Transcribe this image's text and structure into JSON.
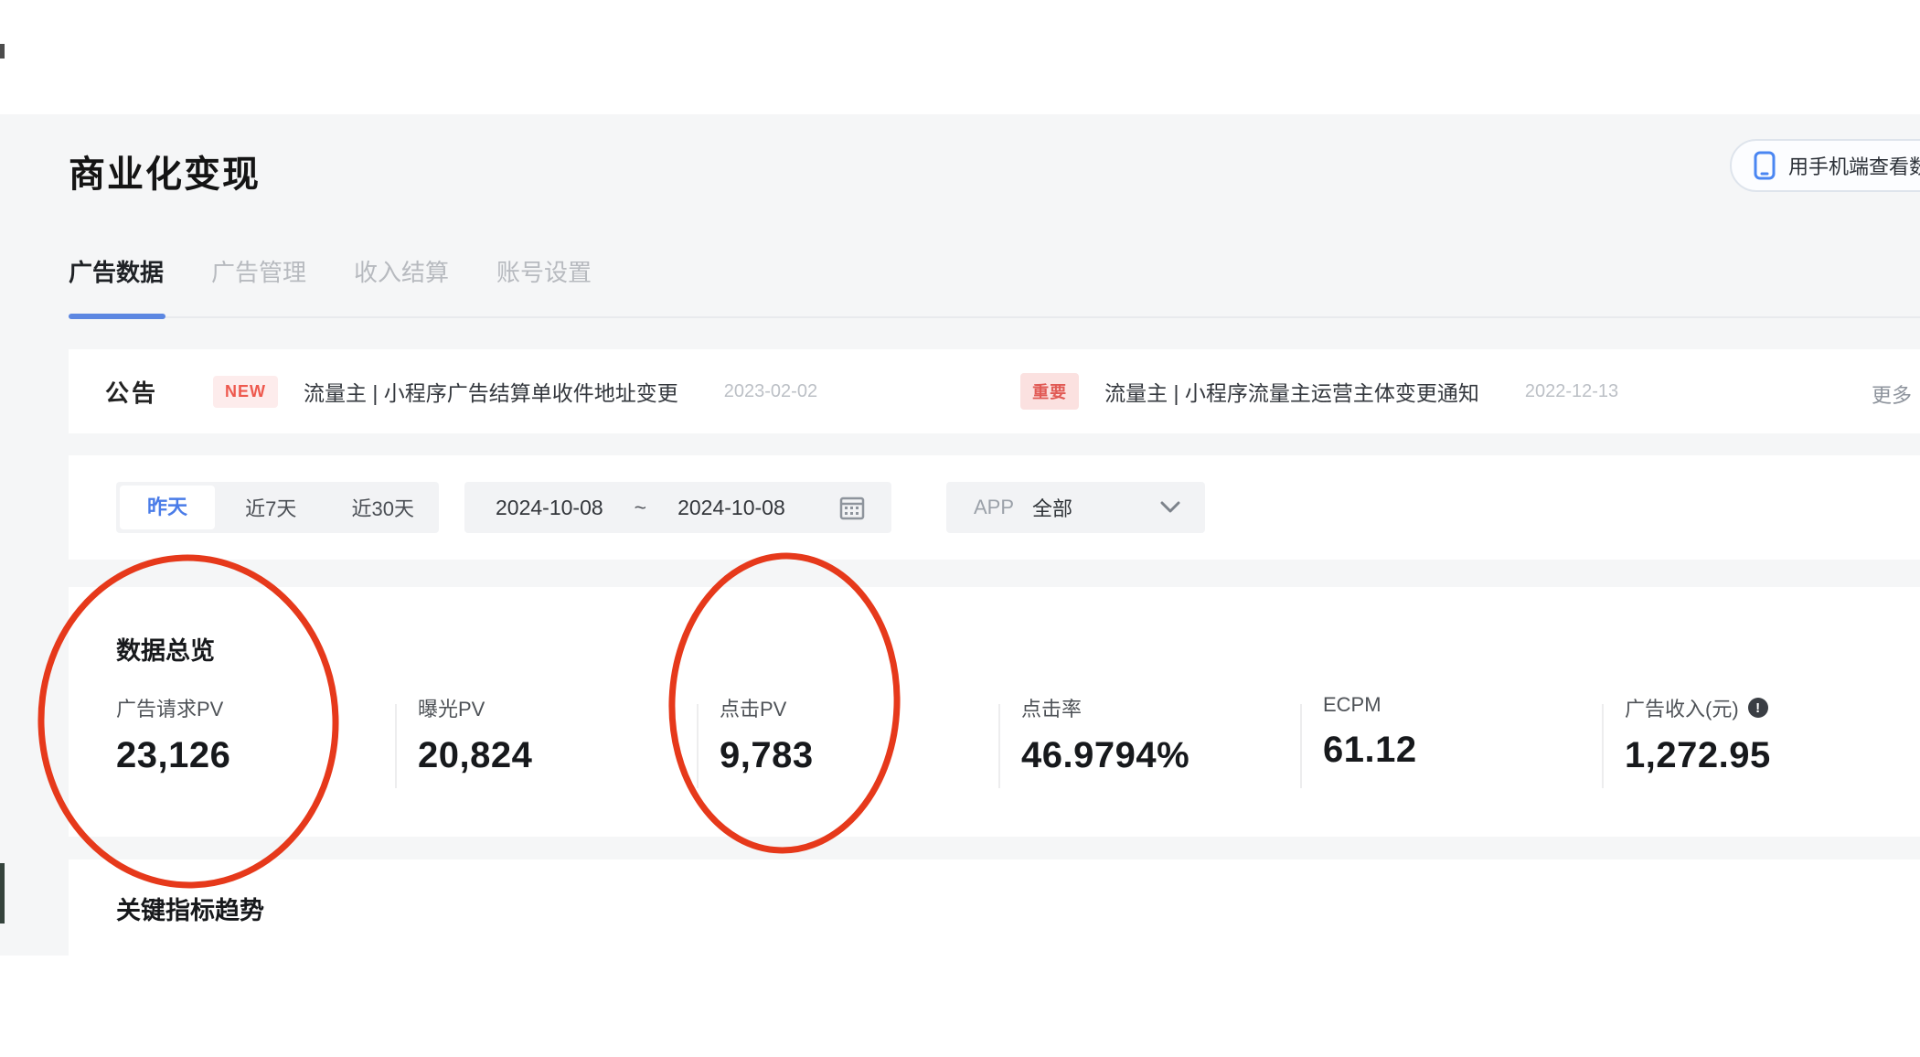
{
  "page": {
    "title": "商业化变现"
  },
  "header_button": {
    "label": "用手机端查看数据"
  },
  "tabs": {
    "items": [
      {
        "label": "广告数据",
        "active": true
      },
      {
        "label": "广告管理",
        "active": false
      },
      {
        "label": "收入结算",
        "active": false
      },
      {
        "label": "账号设置",
        "active": false
      }
    ]
  },
  "notice": {
    "heading": "公告",
    "items": [
      {
        "badge": "NEW",
        "title": "流量主 | 小程序广告结算单收件地址变更",
        "date": "2023-02-02"
      },
      {
        "badge": "重要",
        "title": "流量主 | 小程序流量主运营主体变更通知",
        "date": "2022-12-13"
      }
    ],
    "more_label": "更多"
  },
  "filters": {
    "quick_ranges": [
      "昨天",
      "近7天",
      "近30天"
    ],
    "selected_range": "昨天",
    "date_start": "2024-10-08",
    "date_separator": "~",
    "date_end": "2024-10-08",
    "app_label": "APP",
    "app_value": "全部"
  },
  "overview": {
    "heading": "数据总览",
    "metrics": [
      {
        "label": "广告请求PV",
        "value": "23,126",
        "circled": true
      },
      {
        "label": "曝光PV",
        "value": "20,824",
        "circled": false
      },
      {
        "label": "点击PV",
        "value": "9,783",
        "circled": true
      },
      {
        "label": "点击率",
        "value": "46.9794%",
        "circled": false
      },
      {
        "label": "ECPM",
        "value": "61.12",
        "circled": false
      },
      {
        "label": "广告收入(元)",
        "value": "1,272.95",
        "circled": false,
        "has_info_icon": true
      }
    ]
  },
  "trends": {
    "heading": "关键指标趋势"
  },
  "colors": {
    "accent_blue": "#4a7ce8",
    "tab_underline_blue": "#5c87e2",
    "badge_text_red": "#ee594e",
    "badge_bg_pink": "#fdecec",
    "annotation_circle_red": "#e6391b",
    "page_background_gray": "#f5f6f7",
    "card_white": "#ffffff"
  }
}
